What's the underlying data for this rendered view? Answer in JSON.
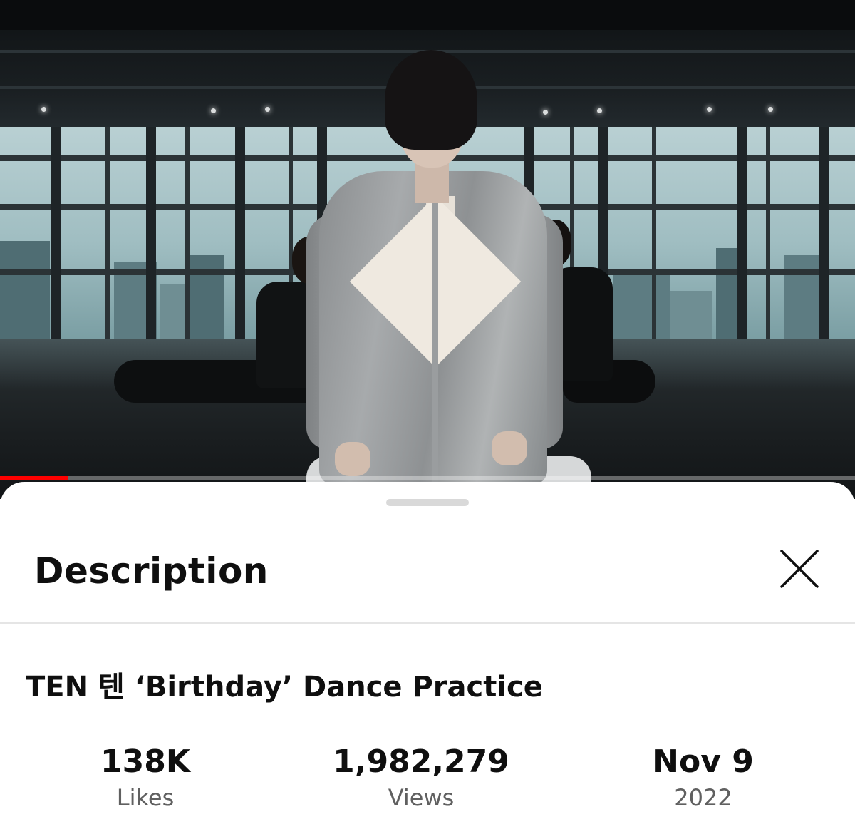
{
  "video": {
    "progress_fraction": 0.08,
    "progress_color": "#ff0000"
  },
  "sheet": {
    "title": "Description",
    "close_icon": "close-icon"
  },
  "video_info": {
    "title": "TEN 텐 ‘Birthday’ Dance Practice",
    "stats": [
      {
        "value": "138K",
        "label": "Likes"
      },
      {
        "value": "1,982,279",
        "label": "Views"
      },
      {
        "value": "Nov 9",
        "label": "2022"
      }
    ]
  }
}
